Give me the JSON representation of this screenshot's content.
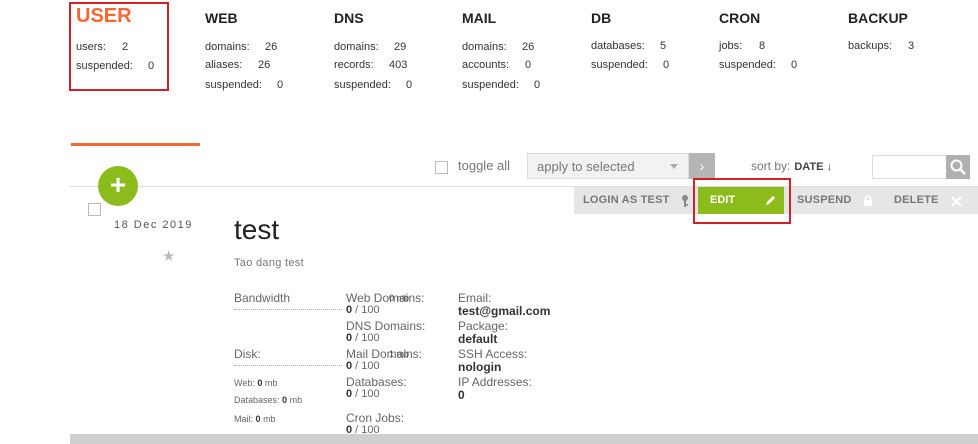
{
  "stats": {
    "user": {
      "title": "USER",
      "rows": [
        {
          "label": "users:",
          "value": "2"
        },
        {
          "label": "suspended:",
          "value": "0"
        }
      ]
    },
    "web": {
      "title": "WEB",
      "rows": [
        {
          "label": "domains:",
          "value": "26"
        },
        {
          "label": "aliases:",
          "value": "26"
        },
        {
          "label": "suspended:",
          "value": "0"
        }
      ]
    },
    "dns": {
      "title": "DNS",
      "rows": [
        {
          "label": "domains:",
          "value": "29"
        },
        {
          "label": "records:",
          "value": "403"
        },
        {
          "label": "suspended:",
          "value": "0"
        }
      ]
    },
    "mail": {
      "title": "MAIL",
      "rows": [
        {
          "label": "domains:",
          "value": "26"
        },
        {
          "label": "accounts:",
          "value": "0"
        },
        {
          "label": "suspended:",
          "value": "0"
        }
      ]
    },
    "db": {
      "title": "DB",
      "rows": [
        {
          "label": "databases:",
          "value": "5"
        },
        {
          "label": "suspended:",
          "value": "0"
        }
      ]
    },
    "cron": {
      "title": "CRON",
      "rows": [
        {
          "label": "jobs:",
          "value": "8"
        },
        {
          "label": "suspended:",
          "value": "0"
        }
      ]
    },
    "backup": {
      "title": "BACKUP",
      "rows": [
        {
          "label": "backups:",
          "value": "3"
        }
      ]
    }
  },
  "toolbar": {
    "toggle_all": "toggle all",
    "apply_select": "apply to selected",
    "go": "›",
    "sort_by": "sort by:",
    "sort_field": "DATE ↓",
    "search_placeholder": ""
  },
  "actions": {
    "login_as": "LOGIN AS TEST",
    "edit": "EDIT",
    "suspend": "SUSPEND",
    "delete": "DELETE"
  },
  "add_button": "+",
  "user": {
    "date": "18 Dec 2019",
    "star": "★",
    "name": "test",
    "description": "Tao dang test",
    "bandwidth_label": "Bandwidth",
    "bandwidth_value": "0 mb",
    "disk_label": "Disk:",
    "disk_value": "1 mb",
    "disk_web": "Web:",
    "disk_web_val": "0",
    "disk_databases": "Databases:",
    "disk_databases_val": "0",
    "disk_mail": "Mail:",
    "disk_mail_val": "0",
    "unit_mb": "mb",
    "web_domains_label": "Web Domains:",
    "web_domains_used": "0",
    "web_domains_limit": " / 100",
    "dns_domains_label": "DNS Domains:",
    "dns_domains_used": "0",
    "dns_domains_limit": " / 100",
    "mail_domains_label": "Mail Domains:",
    "mail_domains_used": "0",
    "mail_domains_limit": " / 100",
    "databases_label": "Databases:",
    "databases_used": "0",
    "databases_limit": " / 100",
    "cron_label": "Cron Jobs:",
    "cron_used": "0",
    "cron_limit": " / 100",
    "email_label": "Email:",
    "email_value": "test@gmail.com",
    "package_label": "Package:",
    "package_value": "default",
    "ssh_label": "SSH Access:",
    "ssh_value": "nologin",
    "ip_label": "IP Addresses:",
    "ip_value": "0"
  },
  "colors": {
    "accent": "#f7662e",
    "green": "#8cbc1b",
    "highlight": "#d32027"
  }
}
